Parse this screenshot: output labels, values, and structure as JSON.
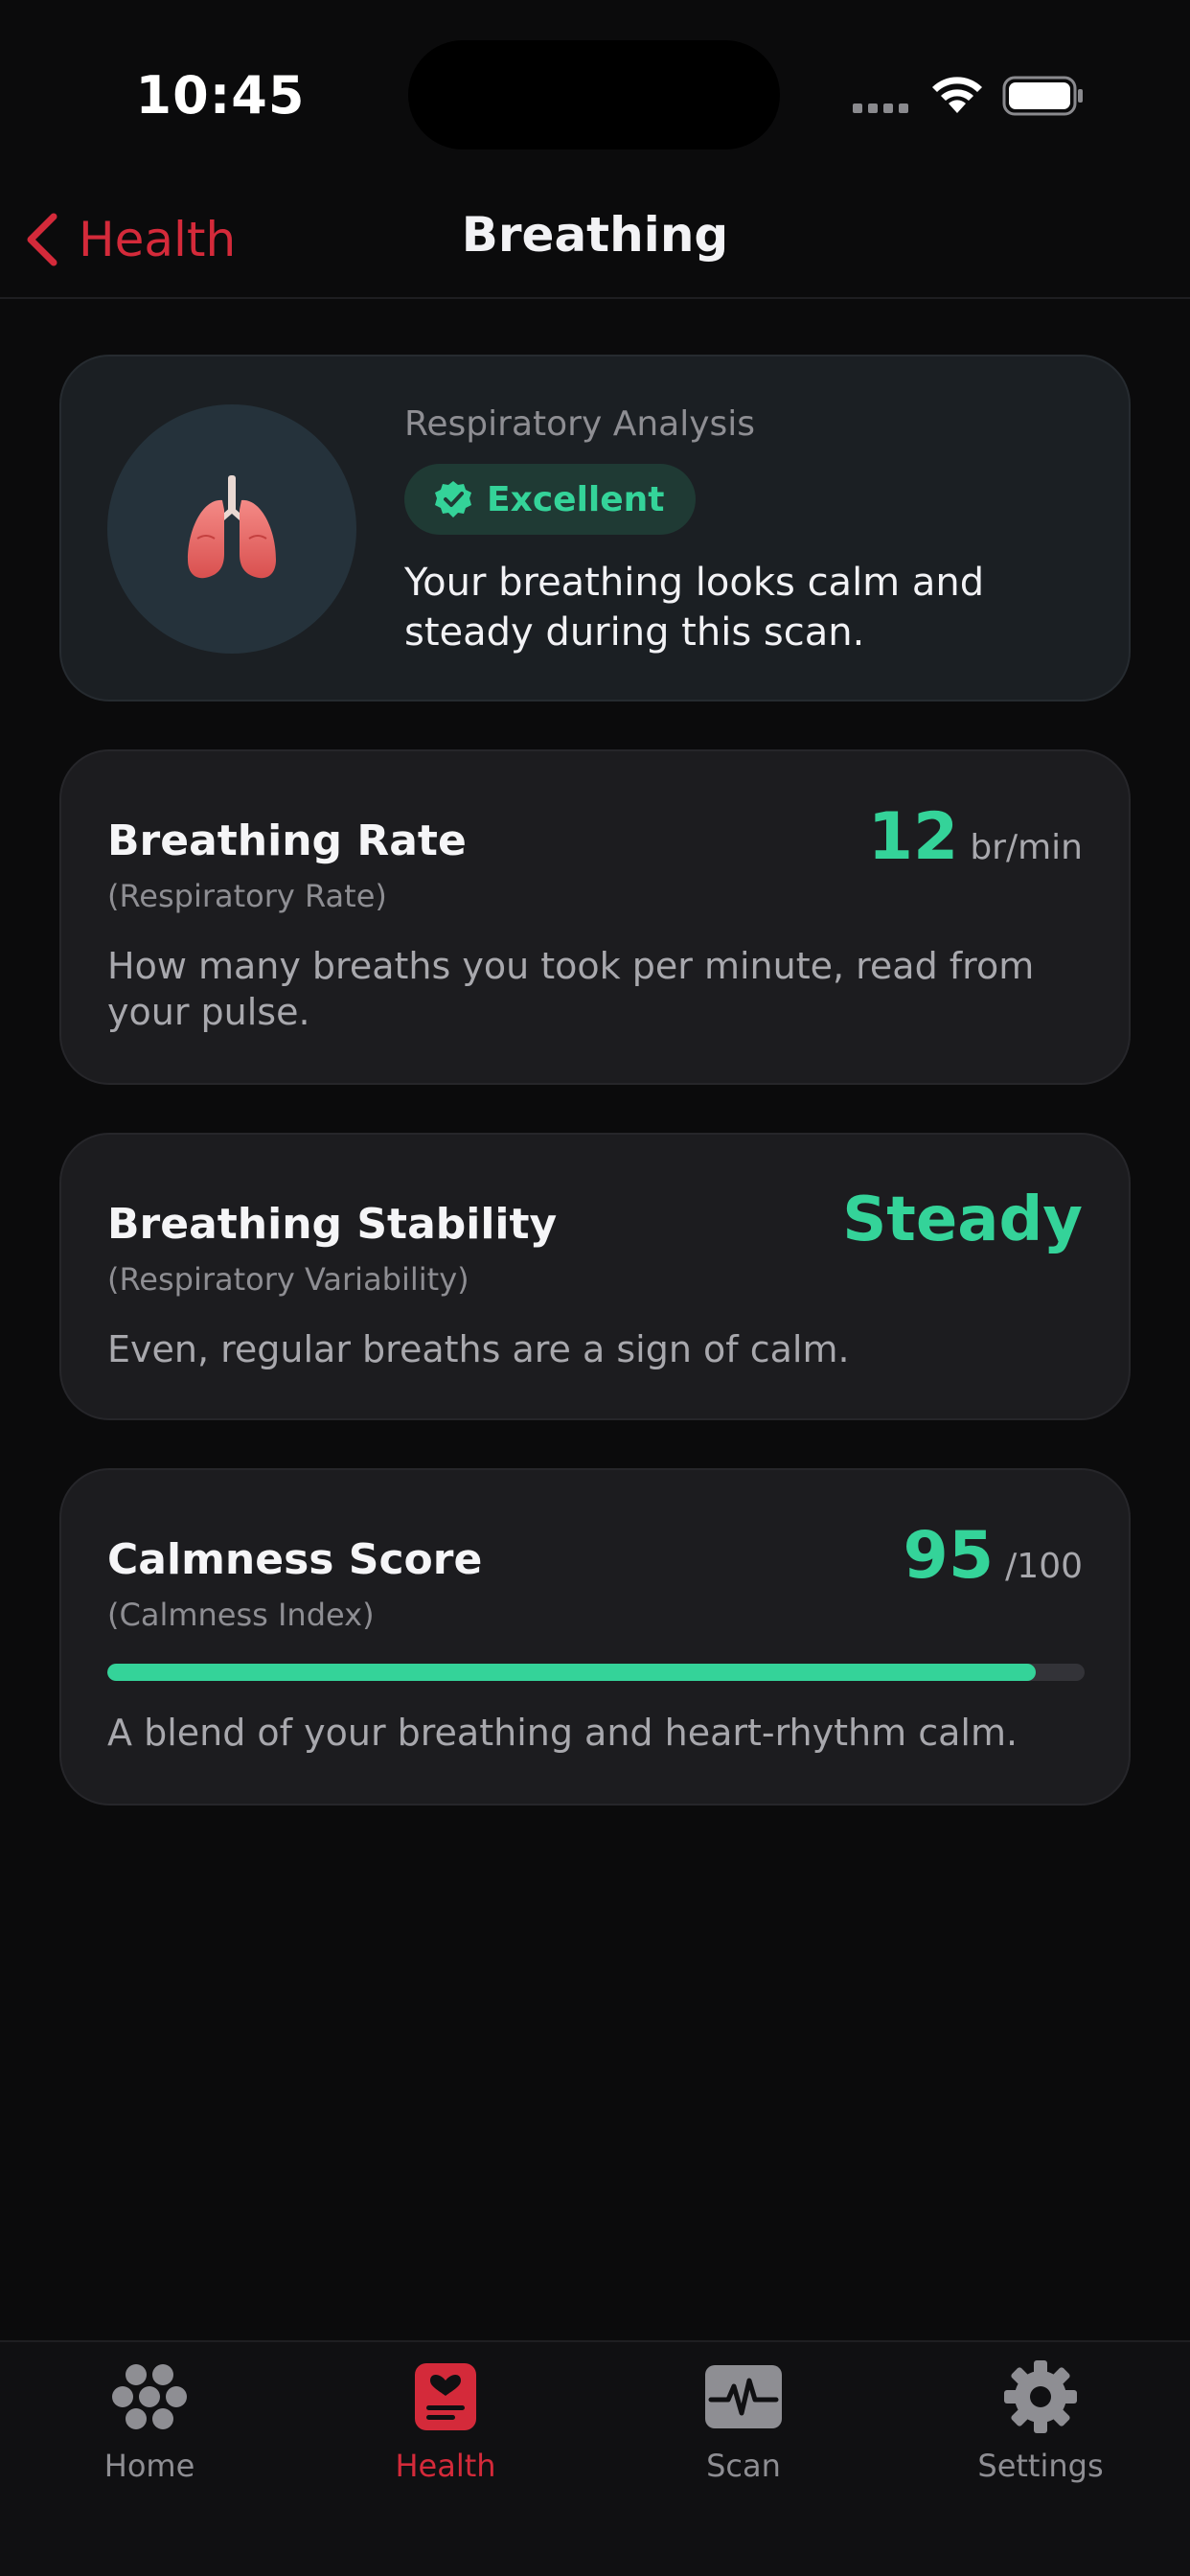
{
  "status_bar": {
    "time": "10:45"
  },
  "nav": {
    "back_label": "Health",
    "title": "Breathing"
  },
  "summary": {
    "label": "Respiratory Analysis",
    "status": "Excellent",
    "message": "Your breathing looks calm and steady during this scan.",
    "icon": "lungs-icon",
    "status_color": "#34d399"
  },
  "metrics": {
    "rate": {
      "title": "Breathing Rate",
      "subtitle": "(Respiratory Rate)",
      "value": "12",
      "unit": "br/min",
      "description": "How many breaths you took per minute, read from your pulse."
    },
    "stability": {
      "title": "Breathing Stability",
      "subtitle": "(Respiratory Variability)",
      "value": "Steady",
      "description": "Even, regular breaths are a sign of calm."
    },
    "calmness": {
      "title": "Calmness Score",
      "subtitle": "(Calmness Index)",
      "value": "95",
      "unit": "/100",
      "progress": 0.95,
      "description": "A blend of your breathing and heart-rhythm calm."
    }
  },
  "tabs": [
    {
      "label": "Home",
      "icon": "home-grid-icon",
      "active": false
    },
    {
      "label": "Health",
      "icon": "health-icon",
      "active": true
    },
    {
      "label": "Scan",
      "icon": "scan-pulse-icon",
      "active": false
    },
    {
      "label": "Settings",
      "icon": "gear-icon",
      "active": false
    }
  ],
  "colors": {
    "accent": "#d42a3a",
    "good": "#34d399",
    "background": "#0b0b0c",
    "card": "#1c1c1f"
  }
}
